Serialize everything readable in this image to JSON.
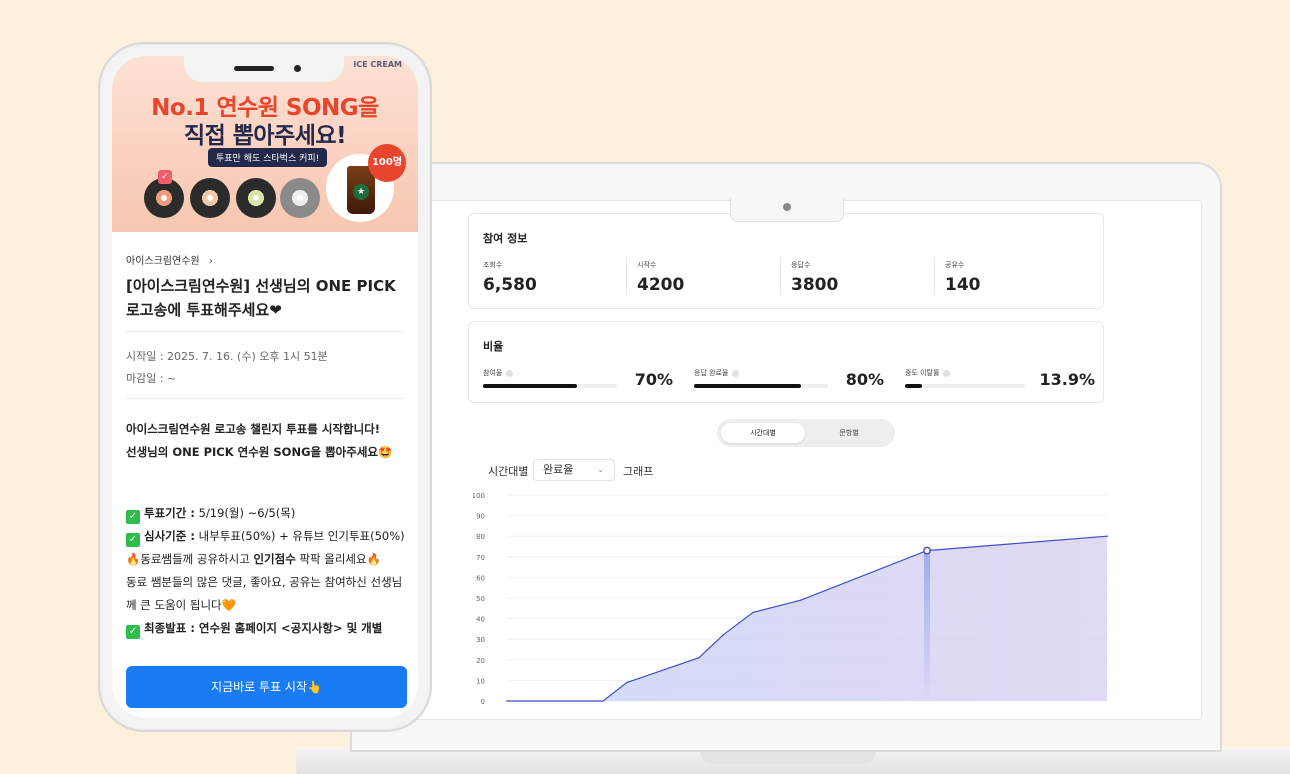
{
  "dashboard": {
    "participation": {
      "title": "참여 정보",
      "stats": [
        {
          "label": "조회수",
          "value": "6,580"
        },
        {
          "label": "시작수",
          "value": "4200"
        },
        {
          "label": "응답수",
          "value": "3800"
        },
        {
          "label": "공유수",
          "value": "140"
        }
      ]
    },
    "ratio": {
      "title": "비율",
      "items": [
        {
          "label": "참여율",
          "value": "70%",
          "fraction": 0.7
        },
        {
          "label": "응답 완료율",
          "value": "80%",
          "fraction": 0.8
        },
        {
          "label": "중도 이탈률",
          "value": "13.9%",
          "fraction": 0.139
        }
      ]
    },
    "tabs": [
      {
        "label": "시간대별",
        "active": true
      },
      {
        "label": "문항별",
        "active": false
      }
    ],
    "filter": {
      "prefix": "시간대별",
      "selected": "완료율",
      "suffix": "그래프"
    }
  },
  "chart_data": {
    "type": "area",
    "ylim": [
      0,
      100
    ],
    "y_ticks": [
      "0",
      "10",
      "20",
      "30",
      "40",
      "50",
      "60",
      "70",
      "80",
      "90",
      "100"
    ],
    "points": [
      {
        "x": 0,
        "y": 0
      },
      {
        "x": 0.16,
        "y": 0
      },
      {
        "x": 0.2,
        "y": 9
      },
      {
        "x": 0.32,
        "y": 21
      },
      {
        "x": 0.36,
        "y": 32
      },
      {
        "x": 0.41,
        "y": 43
      },
      {
        "x": 0.49,
        "y": 49
      },
      {
        "x": 0.7,
        "y": 73
      },
      {
        "x": 1.0,
        "y": 80
      }
    ],
    "highlight_index": 7,
    "colors": {
      "line": "#3f4fc4",
      "fill_start": "#c9d6f7",
      "fill_end": "#dcd2f3"
    }
  },
  "phone": {
    "brand": "ICE CREAM",
    "banner": {
      "line1": "No.1 연수원 SONG을",
      "line2": "직접 뽑아주세요!",
      "pill": "투표만 해도 스타벅스 커피!",
      "badge": "100명"
    },
    "breadcrumb": "아이스크림연수원",
    "title": "[아이스크림연수원] 선생님의 ONE PICK 로고송에 투표해주세요❤",
    "start_date": "시작일 : 2025. 7. 16. (수) 오후 1시 51분",
    "end_date": "마감일 : ~",
    "intro1": "아이스크림연수원 로고송 챌린지 투표를 시작합니다!",
    "intro2": "선생님의 ONE PICK 연수원 SONG을 뽑아주세요🤩",
    "period_label": "투표기간 :",
    "period_value": "5/19(월) ~6/5(목)",
    "criteria_label": "심사기준 :",
    "criteria_value": "내부투표(50%) + 유튜브 인기투표(50%)",
    "share_pre": "동료쌤들께 공유하시고",
    "share_bold": "인기점수",
    "share_post": "팍팍 올리세요",
    "share_note": "동료 쌤분들의 많은 댓글, 좋아요, 공유는 참여하신 선생님께 큰 도움이 됩니다🧡",
    "final_line": "최종발표 : 연수원 홈페이지 <공지사항> 및 개별",
    "cta": "지금바로 투표 시작👆"
  }
}
